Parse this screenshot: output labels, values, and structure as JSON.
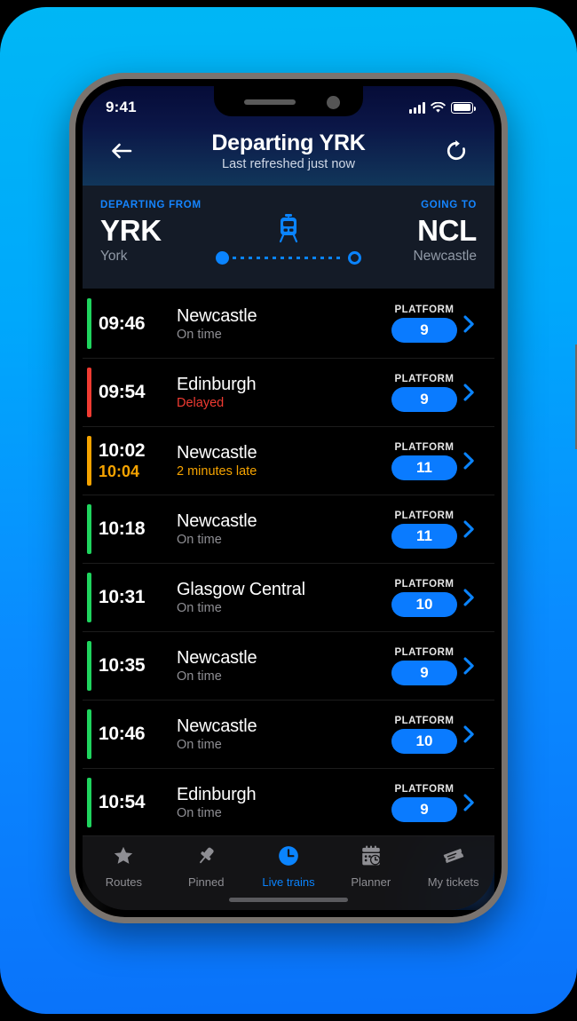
{
  "status_bar": {
    "time": "9:41",
    "signal_icon": "cellular-bars-icon",
    "wifi_icon": "wifi-icon",
    "battery_icon": "battery-icon"
  },
  "header": {
    "back_icon": "back-arrow-icon",
    "title": "Departing YRK",
    "subtitle": "Last refreshed just now",
    "refresh_icon": "refresh-icon"
  },
  "route": {
    "from_label": "DEPARTING FROM",
    "to_label": "GOING TO",
    "from_code": "YRK",
    "from_city": "York",
    "to_code": "NCL",
    "to_city": "Newcastle",
    "train_icon": "train-icon"
  },
  "platform_label": "PLATFORM",
  "chevron_icon": "chevron-right-icon",
  "colors": {
    "on_time": "#1fd45e",
    "delayed": "#f03b32",
    "late": "#f5a300",
    "accent_blue": "#0a84ff",
    "platform_pill": "#0a7bff",
    "muted_text": "#8e8e93"
  },
  "departures": [
    {
      "time": "09:46",
      "revised": "",
      "destination": "Newcastle",
      "status": "On time",
      "state": "on_time",
      "platform": "9"
    },
    {
      "time": "09:54",
      "revised": "",
      "destination": "Edinburgh",
      "status": "Delayed",
      "state": "delayed",
      "platform": "9"
    },
    {
      "time": "10:02",
      "revised": "10:04",
      "destination": "Newcastle",
      "status": "2 minutes late",
      "state": "late",
      "platform": "11"
    },
    {
      "time": "10:18",
      "revised": "",
      "destination": "Newcastle",
      "status": "On time",
      "state": "on_time",
      "platform": "11"
    },
    {
      "time": "10:31",
      "revised": "",
      "destination": "Glasgow Central",
      "status": "On time",
      "state": "on_time",
      "platform": "10"
    },
    {
      "time": "10:35",
      "revised": "",
      "destination": "Newcastle",
      "status": "On time",
      "state": "on_time",
      "platform": "9"
    },
    {
      "time": "10:46",
      "revised": "",
      "destination": "Newcastle",
      "status": "On time",
      "state": "on_time",
      "platform": "10"
    },
    {
      "time": "10:54",
      "revised": "",
      "destination": "Edinburgh",
      "status": "On time",
      "state": "on_time",
      "platform": "9"
    }
  ],
  "tabs": [
    {
      "label": "Routes",
      "icon": "star-icon",
      "active": false
    },
    {
      "label": "Pinned",
      "icon": "pin-icon",
      "active": false
    },
    {
      "label": "Live trains",
      "icon": "clock-icon",
      "active": true
    },
    {
      "label": "Planner",
      "icon": "calendar-clock-icon",
      "active": false
    },
    {
      "label": "My tickets",
      "icon": "ticket-icon",
      "active": false
    }
  ]
}
